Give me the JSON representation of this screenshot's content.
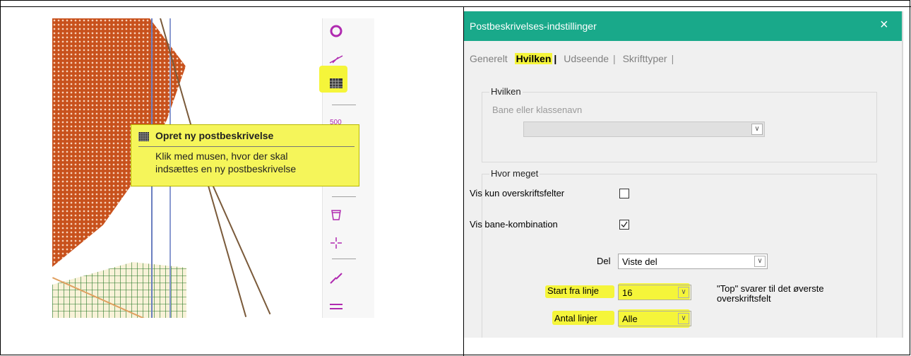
{
  "left": {
    "tooltip_title": "Opret ny postbeskrivelse",
    "tooltip_line1": "Klik med musen, hvor der skal",
    "tooltip_line2": "indsættes en ny postbeskrivelse",
    "toolbar_icons": [
      "circle-icon",
      "measure-icon",
      "control-description-icon",
      "numbering-icon",
      "bucket-icon",
      "crosshair-icon",
      "line-break-icon",
      "parallel-lines-icon"
    ]
  },
  "dialog": {
    "title": "Postbeskrivelses-indstillinger",
    "close": "×",
    "tabs": [
      "Generelt",
      "Hvilken",
      "Udseende",
      "Skrifttyper"
    ],
    "active_tab": "Hvilken",
    "group1": {
      "label": "Hvilken",
      "field_label": "Bane eller klassenavn",
      "field_value": ""
    },
    "group2": {
      "label": "Hvor meget",
      "cb_headers_label": "Vis kun overskriftsfelter",
      "cb_headers_checked": false,
      "cb_combo_label": "Vis bane-kombination",
      "cb_combo_checked": true,
      "del_label": "Del",
      "del_value": "Viste del",
      "start_label": "Start fra linje",
      "start_value": "16",
      "count_label": "Antal linjer",
      "count_value": "Alle",
      "note_line1": "\"Top\" svarer til det øverste",
      "note_line2": "overskriftsfelt"
    }
  },
  "colors": {
    "titlebar": "#19a98a",
    "highlight": "#f5f53a",
    "tooltip_bg": "#f5f55a",
    "toolbar_icon": "#b02ab0",
    "map_orange": "#c8511c"
  }
}
